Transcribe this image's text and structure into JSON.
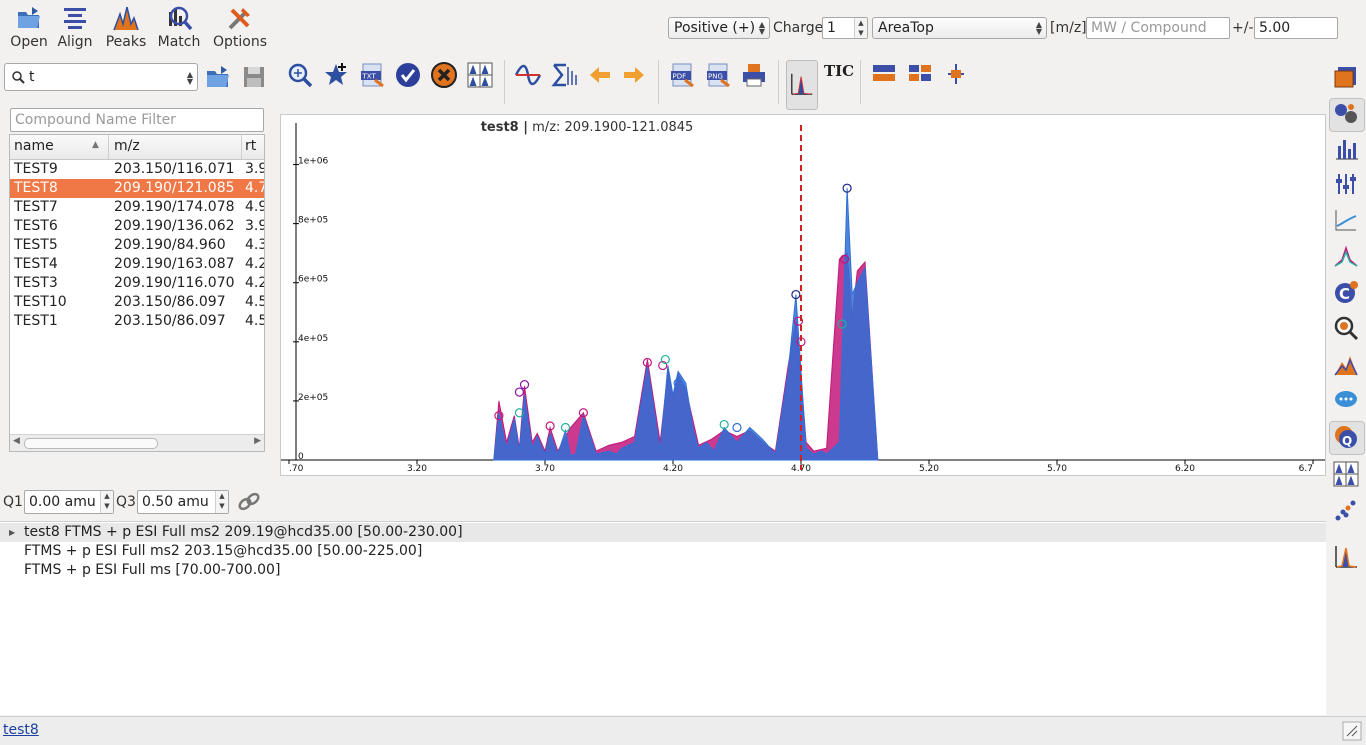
{
  "toolbar": {
    "buttons": [
      {
        "label": "Open",
        "icon": "open-folder-icon"
      },
      {
        "label": "Align",
        "icon": "align-icon"
      },
      {
        "label": "Peaks",
        "icon": "peaks-icon"
      },
      {
        "label": "Match",
        "icon": "match-icon"
      },
      {
        "label": "Options",
        "icon": "options-icon"
      }
    ]
  },
  "ionization": {
    "selected": "Positive (+)"
  },
  "charge": {
    "label": "Charge",
    "value": "1"
  },
  "quant_type": {
    "selected": "AreaTop"
  },
  "mz": {
    "label": "[m/z]",
    "placeholder": "MW / Compound",
    "tol_label": "+/-",
    "tol_value": "5.00"
  },
  "project": {
    "selected": "t"
  },
  "compound_filter": {
    "placeholder": "Compound Name Filter"
  },
  "compound_table": {
    "columns": [
      "name",
      "m/z",
      "rt"
    ],
    "rows": [
      {
        "name": "TEST9",
        "mz": "203.150/116.071",
        "rt": "3.9"
      },
      {
        "name": "TEST8",
        "mz": "209.190/121.085",
        "rt": "4.7",
        "selected": true
      },
      {
        "name": "TEST7",
        "mz": "209.190/174.078",
        "rt": "4.9"
      },
      {
        "name": "TEST6",
        "mz": "209.190/136.062",
        "rt": "3.9"
      },
      {
        "name": "TEST5",
        "mz": "209.190/84.960",
        "rt": "4.3"
      },
      {
        "name": "TEST4",
        "mz": "209.190/163.087",
        "rt": "4.2"
      },
      {
        "name": "TEST3",
        "mz": "209.190/116.070",
        "rt": "4.2"
      },
      {
        "name": "TEST10",
        "mz": "203.150/86.097",
        "rt": "4.5"
      },
      {
        "name": "TEST1",
        "mz": "203.150/86.097",
        "rt": "4.5"
      }
    ]
  },
  "q1": {
    "label": "Q1",
    "value": "0.00 amu"
  },
  "q3": {
    "label": "Q3",
    "value": "0.50 amu"
  },
  "plot_toolbar": {
    "tic_label": "TIC"
  },
  "chart_data": {
    "type": "area",
    "title_bold": "test8 |",
    "title_rest": " m/z: 209.1900-121.0845",
    "xlim": [
      2.7,
      6.7
    ],
    "ylim": [
      0,
      1100000
    ],
    "x_ticks": [
      ".70",
      "3.20",
      "3.70",
      "4.20",
      "4.70",
      "5.20",
      "5.70",
      "6.20",
      "6.7"
    ],
    "y_ticks": [
      "0",
      "2e+05",
      "4e+05",
      "6e+05",
      "8e+05",
      "1e+06"
    ],
    "marker_rt": 4.7,
    "series": [
      {
        "color": "#2f6fd6",
        "x": [
          3.5,
          3.52,
          3.55,
          3.58,
          3.6,
          3.62,
          3.65,
          3.67,
          3.7,
          3.72,
          3.75,
          3.78,
          3.8,
          3.82,
          3.85,
          3.9,
          3.95,
          3.98,
          4.0,
          4.05,
          4.1,
          4.15,
          4.18,
          4.2,
          4.22,
          4.25,
          4.28,
          4.3,
          4.33,
          4.36,
          4.4,
          4.45,
          4.5,
          4.55,
          4.6,
          4.65,
          4.68,
          4.7,
          4.72,
          4.75,
          4.78,
          4.8,
          4.85,
          4.88,
          4.9,
          4.92,
          4.95,
          5.0
        ],
        "y": [
          0,
          160000,
          40000,
          140000,
          30000,
          220000,
          40000,
          80000,
          20000,
          90000,
          20000,
          100000,
          15000,
          20000,
          150000,
          20000,
          30000,
          20000,
          40000,
          60000,
          320000,
          30000,
          320000,
          220000,
          300000,
          260000,
          100000,
          40000,
          60000,
          30000,
          110000,
          60000,
          110000,
          70000,
          20000,
          300000,
          560000,
          300000,
          40000,
          20000,
          30000,
          20000,
          60000,
          920000,
          560000,
          600000,
          650000,
          0
        ]
      },
      {
        "color": "#c2187a",
        "x": [
          3.5,
          3.52,
          3.55,
          3.58,
          3.6,
          3.62,
          3.65,
          3.67,
          3.7,
          3.72,
          3.75,
          3.8,
          3.85,
          3.9,
          3.95,
          4.0,
          4.05,
          4.1,
          4.15,
          4.18,
          4.2,
          4.22,
          4.25,
          4.3,
          4.35,
          4.4,
          4.45,
          4.5,
          4.55,
          4.6,
          4.65,
          4.68,
          4.7,
          4.72,
          4.75,
          4.8,
          4.85,
          4.88,
          4.9,
          4.92,
          4.95,
          5.0
        ],
        "y": [
          0,
          200000,
          60000,
          150000,
          40000,
          250000,
          60000,
          90000,
          30000,
          110000,
          30000,
          110000,
          160000,
          30000,
          50000,
          60000,
          80000,
          340000,
          60000,
          300000,
          210000,
          290000,
          240000,
          50000,
          70000,
          100000,
          80000,
          100000,
          60000,
          30000,
          320000,
          470000,
          280000,
          60000,
          30000,
          40000,
          680000,
          700000,
          480000,
          640000,
          670000,
          0
        ]
      }
    ],
    "markers": [
      {
        "x": 3.52,
        "y": 150000,
        "color": "#c2187a"
      },
      {
        "x": 3.6,
        "y": 230000,
        "color": "#8a10a8"
      },
      {
        "x": 3.62,
        "y": 255000,
        "color": "#8a10a8"
      },
      {
        "x": 3.6,
        "y": 160000,
        "color": "#20b0a0"
      },
      {
        "x": 3.72,
        "y": 115000,
        "color": "#c2187a"
      },
      {
        "x": 3.78,
        "y": 110000,
        "color": "#20b0a0"
      },
      {
        "x": 3.85,
        "y": 160000,
        "color": "#c2187a"
      },
      {
        "x": 4.1,
        "y": 330000,
        "color": "#c2187a"
      },
      {
        "x": 4.16,
        "y": 320000,
        "color": "#c2187a"
      },
      {
        "x": 4.17,
        "y": 340000,
        "color": "#20b0a0"
      },
      {
        "x": 4.22,
        "y": 260000,
        "color": "#2f6fd6"
      },
      {
        "x": 4.4,
        "y": 120000,
        "color": "#20b0a0"
      },
      {
        "x": 4.45,
        "y": 110000,
        "color": "#2f6fd6"
      },
      {
        "x": 4.68,
        "y": 560000,
        "color": "#1a237e"
      },
      {
        "x": 4.69,
        "y": 470000,
        "color": "#c2187a"
      },
      {
        "x": 4.7,
        "y": 400000,
        "color": "#c2187a"
      },
      {
        "x": 4.88,
        "y": 920000,
        "color": "#1a237e"
      },
      {
        "x": 4.87,
        "y": 680000,
        "color": "#c2187a"
      },
      {
        "x": 4.86,
        "y": 460000,
        "color": "#20b0a0"
      }
    ]
  },
  "scans": [
    {
      "text": "test8 FTMS + p ESI Full ms2 209.19@hcd35.00 [50.00-230.00]",
      "expandable": true,
      "highlight": true
    },
    {
      "text": "FTMS + p ESI Full ms2 203.15@hcd35.00 [50.00-225.00]"
    },
    {
      "text": "FTMS + p ESI Full ms [70.00-700.00]"
    }
  ],
  "status": {
    "link": "test8"
  }
}
